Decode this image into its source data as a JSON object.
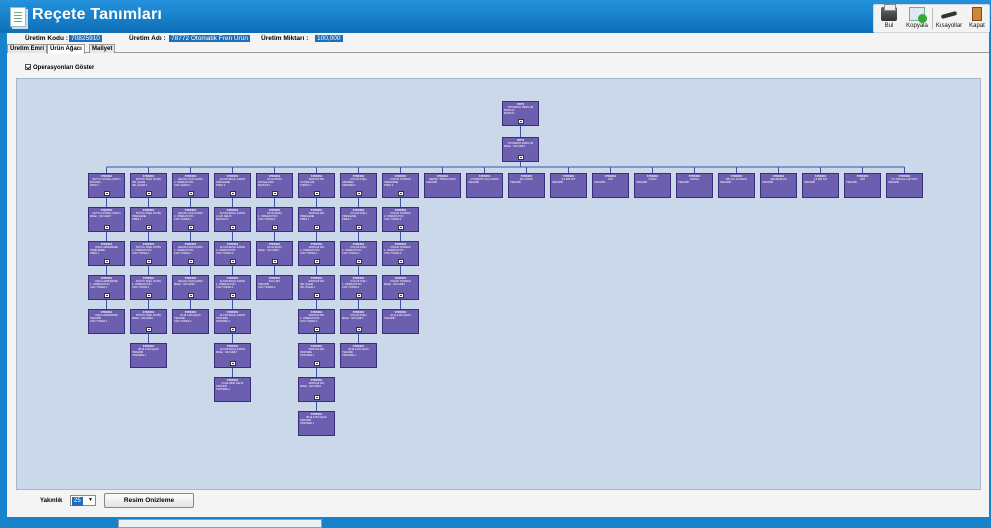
{
  "window": {
    "title": "Reçete Tanımları"
  },
  "toolbar": {
    "buttons": [
      {
        "label": "Bul",
        "icon": "printer-icon"
      },
      {
        "label": "Kopyala",
        "icon": "copy-icon"
      },
      {
        "label": "Kısayollar",
        "icon": "shortcut-icon"
      },
      {
        "label": "Kapat",
        "icon": "exit-icon"
      }
    ]
  },
  "info": {
    "code_label": "Üretim Kodu :",
    "code_value": "70825910",
    "name_label": "Üretim Adı :",
    "name_value": "78772 Otomatik Fren Ürün",
    "qty_label": "Üretim Miktarı :",
    "qty_value": "100,000"
  },
  "tabs": [
    "Üretim Emri",
    "Ürün Ağacı",
    "Maliyet"
  ],
  "checkbox": {
    "label": "Operasyonları Göster",
    "checked": true
  },
  "tree": {
    "root": {
      "code": "78772",
      "name": "OTOMATIK FREN ÇB",
      "lines": [
        "MONTAJ",
        "MONTAJ"
      ]
    },
    "level1": {
      "code": "78772",
      "name": "OTOMATIK FREN ÇB",
      "lines": [
        "Miktar : 100 ADET"
      ]
    },
    "columns": [
      {
        "items": [
          {
            "code": "STDK001",
            "name": "FETTU GÖVDE (16027)",
            "lines": [
              "BOYAMA",
              "FIRIN 1"
            ]
          },
          {
            "code": "STDK001",
            "name": "FETTU GÖVDE (16027)",
            "lines": [
              "Miktar : 100 ADET"
            ]
          },
          {
            "code": "STDK001",
            "name": "DIŞLİ HAMMADDE",
            "lines": [
              "TEMİZLEME",
              "PRES 1"
            ]
          },
          {
            "code": "STDK001",
            "name": "DIŞLİ HAMMADDE",
            "lines": [
              "1. OPERASYON",
              "CNC TORNA 1"
            ]
          },
          {
            "code": "STDK001",
            "name": "DIŞLİ HAMMADDE",
            "lines": [
              "TEDARİK",
              "CNC TORNA 1"
            ]
          }
        ]
      },
      {
        "items": [
          {
            "code": "STDK001",
            "name": "BÜYÜK DİŞLİ 18 DİŞ",
            "lines": [
              "ISIL İŞLEM",
              "ISIL İŞLEM 1"
            ]
          },
          {
            "code": "STDK001",
            "name": "BÜYÜK DİŞLİ 18 DİŞ",
            "lines": [
              "PRESLEME",
              "PRES 1"
            ]
          },
          {
            "code": "STDK001",
            "name": "BÜYÜK DİŞLİ 18 DİŞ",
            "lines": [
              "2. OPERASYON",
              "CNC TORNA 1"
            ]
          },
          {
            "code": "STDK001",
            "name": "BÜYÜK DİŞLİ 18 DİŞ",
            "lines": [
              "1. OPERASYON",
              "CNC TORNA 1"
            ]
          },
          {
            "code": "STDK001",
            "name": "BÜYÜK DİŞLİ 18 DİŞ",
            "lines": [
              "Miktar : 100 ADET"
            ]
          },
          {
            "code": "STDK001",
            "name": "38 lik 4140 ÇELİK",
            "lines": [
              "TEDARİK",
              "TESTERE 1"
            ]
          }
        ]
      },
      {
        "items": [
          {
            "code": "STDK001",
            "name": "DELİKLİ FAN KAPAK",
            "lines": [
              "2. OPERASYON",
              "CNC ÇEKİM 1"
            ]
          },
          {
            "code": "STDK001",
            "name": "DELİKLİ FAN KAPAK",
            "lines": [
              "2. OPERASYON",
              "CNC TORNA 1"
            ]
          },
          {
            "code": "STDK001",
            "name": "DELİKLİ FAN KAPAK",
            "lines": [
              "1. OPERASYON",
              "CNC TORNA 1"
            ]
          },
          {
            "code": "STDK001",
            "name": "DELİKLİ FAN KAPAK",
            "lines": [
              "Miktar : 100 ADET"
            ]
          },
          {
            "code": "STDK001",
            "name": "32 lik 4140 ÇELİK",
            "lines": [
              "TEDARİK",
              "CNC TORNA 2"
            ]
          }
        ]
      },
      {
        "items": [
          {
            "code": "STDK001",
            "name": "ALYAN BAŞLI KAPAK",
            "lines": [
              "PRESLEME",
              "PRES 2"
            ]
          },
          {
            "code": "STDK001",
            "name": "ALYAN BAŞLI KAPAK",
            "lines": [
              "4 LÜK DELİK",
              "MATKAP 1"
            ]
          },
          {
            "code": "STDK001",
            "name": "ALYAN BAŞLI KAPAK",
            "lines": [
              "2. OPERASYON",
              "CNC TORNA 2"
            ]
          },
          {
            "code": "STDK001",
            "name": "ALYAN BAŞLI KAPAK",
            "lines": [
              "1. OPERASYON",
              "CNC TORNA 1"
            ]
          },
          {
            "code": "STDK001",
            "name": "ALYAN BAŞLI KAPAK",
            "lines": [
              "TESTERE",
              "TESTERE 1"
            ]
          },
          {
            "code": "STDK001",
            "name": "ALYAN BAŞLI KAPAK",
            "lines": [
              "Miktar : 100 ADET"
            ]
          },
          {
            "code": "STDK001",
            "name": "34 lük 8620 ÇELİK",
            "lines": [
              "TEDARİK",
              "TESTERE 1"
            ]
          }
        ]
      },
      {
        "items": [
          {
            "code": "STDK001",
            "name": "34 lük BURÇ",
            "lines": [
              "HAVŞALAMA",
              "MATKAP 1"
            ]
          },
          {
            "code": "STDK001",
            "name": "34 lük BURÇ",
            "lines": [
              "1. OPERASYON",
              "CNC TORNA 4"
            ]
          },
          {
            "code": "STDK001",
            "name": "34 lük BURÇ",
            "lines": [
              "Miktar : 100 ADET"
            ]
          },
          {
            "code": "STDK001",
            "name": "34'LÜ MİL",
            "lines": [
              "TEDARİK",
              "CNC TORNA 4"
            ]
          }
        ]
      },
      {
        "items": [
          {
            "code": "STDK001",
            "name": "SONSUZ MİL",
            "lines": [
              "6 KÖŞE DIŞ",
              "TORNA 1"
            ]
          },
          {
            "code": "STDK001",
            "name": "SONSUZ MİL",
            "lines": [
              "PRESLEME",
              "PRES 1"
            ]
          },
          {
            "code": "STDK001",
            "name": "SONSUZ MİL",
            "lines": [
              "2. OPERASYON",
              "CNC TORNA 1"
            ]
          },
          {
            "code": "STDK001",
            "name": "SONSUZ MİL",
            "lines": [
              "ISIL İŞLEM",
              "ISIL İŞLEM 1"
            ]
          },
          {
            "code": "STDK001",
            "name": "SONSUZ MİL",
            "lines": [
              "1. OPERASYON",
              "CNC TORNA 3"
            ]
          },
          {
            "code": "STDK001",
            "name": "SONSUZ MİL",
            "lines": [
              "TESTERE",
              "TESTERE 1"
            ]
          },
          {
            "code": "STDK001",
            "name": "SONSUZ MİL",
            "lines": [
              "Miktar : 100 ADET"
            ]
          },
          {
            "code": "STDK001",
            "name": "38 lik 4140 ÇELİK",
            "lines": [
              "TEDARİK",
              "TESTERE 1"
            ]
          }
        ]
      },
      {
        "items": [
          {
            "code": "STDK001",
            "name": "KÜÇÜK DİŞLİ",
            "lines": [
              "AZDIRMA",
              "AZDIRMA 1"
            ]
          },
          {
            "code": "STDK001",
            "name": "KÜÇÜK DİŞLİ",
            "lines": [
              "PRESLEME",
              "PRES 2"
            ]
          },
          {
            "code": "STDK001",
            "name": "KÜÇÜK DİŞLİ",
            "lines": [
              "2. OPERASYON",
              "CNC TORNA 4"
            ]
          },
          {
            "code": "STDK001",
            "name": "KÜÇÜK DİŞLİ",
            "lines": [
              "1. OPERASYON",
              "CNC TORNA 4"
            ]
          },
          {
            "code": "STDK001",
            "name": "KÜÇÜK DİŞLİ",
            "lines": [
              "Miktar : 100 ADET"
            ]
          },
          {
            "code": "STDK001",
            "name": "38 lik 4140 ÇELİK",
            "lines": [
              "TEDARİK",
              "TESTERE 1"
            ]
          }
        ]
      },
      {
        "items": [
          {
            "code": "STDK001",
            "name": "KÜÇÜK SONSUZ",
            "lines": [
              "PRESLEME",
              "PRES 2"
            ]
          },
          {
            "code": "STDK001",
            "name": "KÜÇÜK SONSUZ",
            "lines": [
              "2. OPERASYON",
              "CNC TORNA 4"
            ]
          },
          {
            "code": "STDK001",
            "name": "KÜÇÜK SONSUZ",
            "lines": [
              "1. OPERASYON",
              "CNC TORNA 4"
            ]
          },
          {
            "code": "STDK001",
            "name": "KÜÇÜK SONSUZ",
            "lines": [
              "Miktar : 100 ADET"
            ]
          },
          {
            "code": "STDK001",
            "name": "32 lik 4140 ÇELİK",
            "lines": [
              "TEDARİK"
            ]
          }
        ]
      },
      {
        "items": [
          {
            "code": "STDK001",
            "name": "SEKİZLİ TİPPE KAPAK",
            "lines": [
              "TEDARİK"
            ]
          }
        ]
      },
      {
        "items": [
          {
            "code": "STDK001",
            "name": "OTOMATİK VAÇ KAPAK",
            "lines": [
              "TEDARİK"
            ]
          }
        ]
      },
      {
        "items": [
          {
            "code": "STDK001",
            "name": "M4 CİVATA",
            "lines": [
              "TEDARİK"
            ]
          }
        ]
      },
      {
        "items": [
          {
            "code": "STDK001",
            "name": "0,5 MM TAT",
            "lines": [
              "TEDARİK"
            ]
          }
        ]
      },
      {
        "items": [
          {
            "code": "STDK001",
            "name": "PİM",
            "lines": [
              "TEDARİK"
            ]
          }
        ]
      },
      {
        "items": [
          {
            "code": "STDK001",
            "name": "YÜZÜK",
            "lines": [
              "TEDARİK"
            ]
          }
        ]
      },
      {
        "items": [
          {
            "code": "STDK001",
            "name": "ORING",
            "lines": [
              "TEDARİK"
            ]
          }
        ]
      },
      {
        "items": [
          {
            "code": "STDK001",
            "name": "BİLYALI RULMAN",
            "lines": [
              "TEDARİK"
            ]
          }
        ]
      },
      {
        "items": [
          {
            "code": "STDK001",
            "name": "SEGMANLAR",
            "lines": [
              "TEDARİK"
            ]
          }
        ]
      },
      {
        "items": [
          {
            "code": "STDK001",
            "name": "1,5 MM TAT",
            "lines": [
              "TEDARİK"
            ]
          }
        ]
      },
      {
        "items": [
          {
            "code": "STDK001",
            "name": "PİM",
            "lines": [
              "TEDARİK"
            ]
          }
        ]
      },
      {
        "items": [
          {
            "code": "STDK001",
            "name": "0,5 CIRCLE CAPTION",
            "lines": [
              "TEDARİK"
            ]
          }
        ]
      }
    ]
  },
  "bottom": {
    "zoom_label": "Yakınlık",
    "zoom_value": "25",
    "preview_label": "Resim Onizleme"
  },
  "colors": {
    "accent": "#1783cc",
    "node_fill": "#6d5fb0",
    "canvas_bg": "#cad8ea"
  }
}
